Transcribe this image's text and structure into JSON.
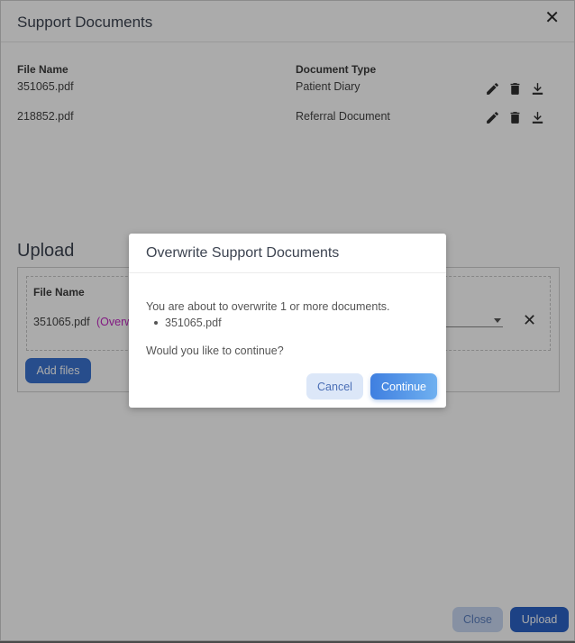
{
  "dialog": {
    "title": "Support Documents",
    "close_icon": "close-icon",
    "columns": {
      "file_name": "File Name",
      "document_type": "Document Type"
    },
    "documents": [
      {
        "file_name": "351065.pdf",
        "document_type": "Patient Diary"
      },
      {
        "file_name": "218852.pdf",
        "document_type": "Referral Document"
      }
    ],
    "row_icons": [
      "pencil-icon",
      "trash-icon",
      "download-icon"
    ]
  },
  "upload": {
    "title": "Upload",
    "file_name_header": "File Name",
    "file_name": "351065.pdf",
    "overwrite_label": "(Overw",
    "add_files_label": "Add files"
  },
  "footer": {
    "close_label": "Close",
    "upload_label": "Upload"
  },
  "modal": {
    "title": "Overwrite Support Documents",
    "message": "You are about to overwrite 1 or more documents.",
    "files": [
      "351065.pdf"
    ],
    "question": "Would you like to continue?",
    "cancel_label": "Cancel",
    "continue_label": "Continue"
  },
  "colors": {
    "primary": "#2c63c6",
    "overwrite_text": "#c228c2",
    "overlay": "rgba(0,0,0,0.33)"
  }
}
